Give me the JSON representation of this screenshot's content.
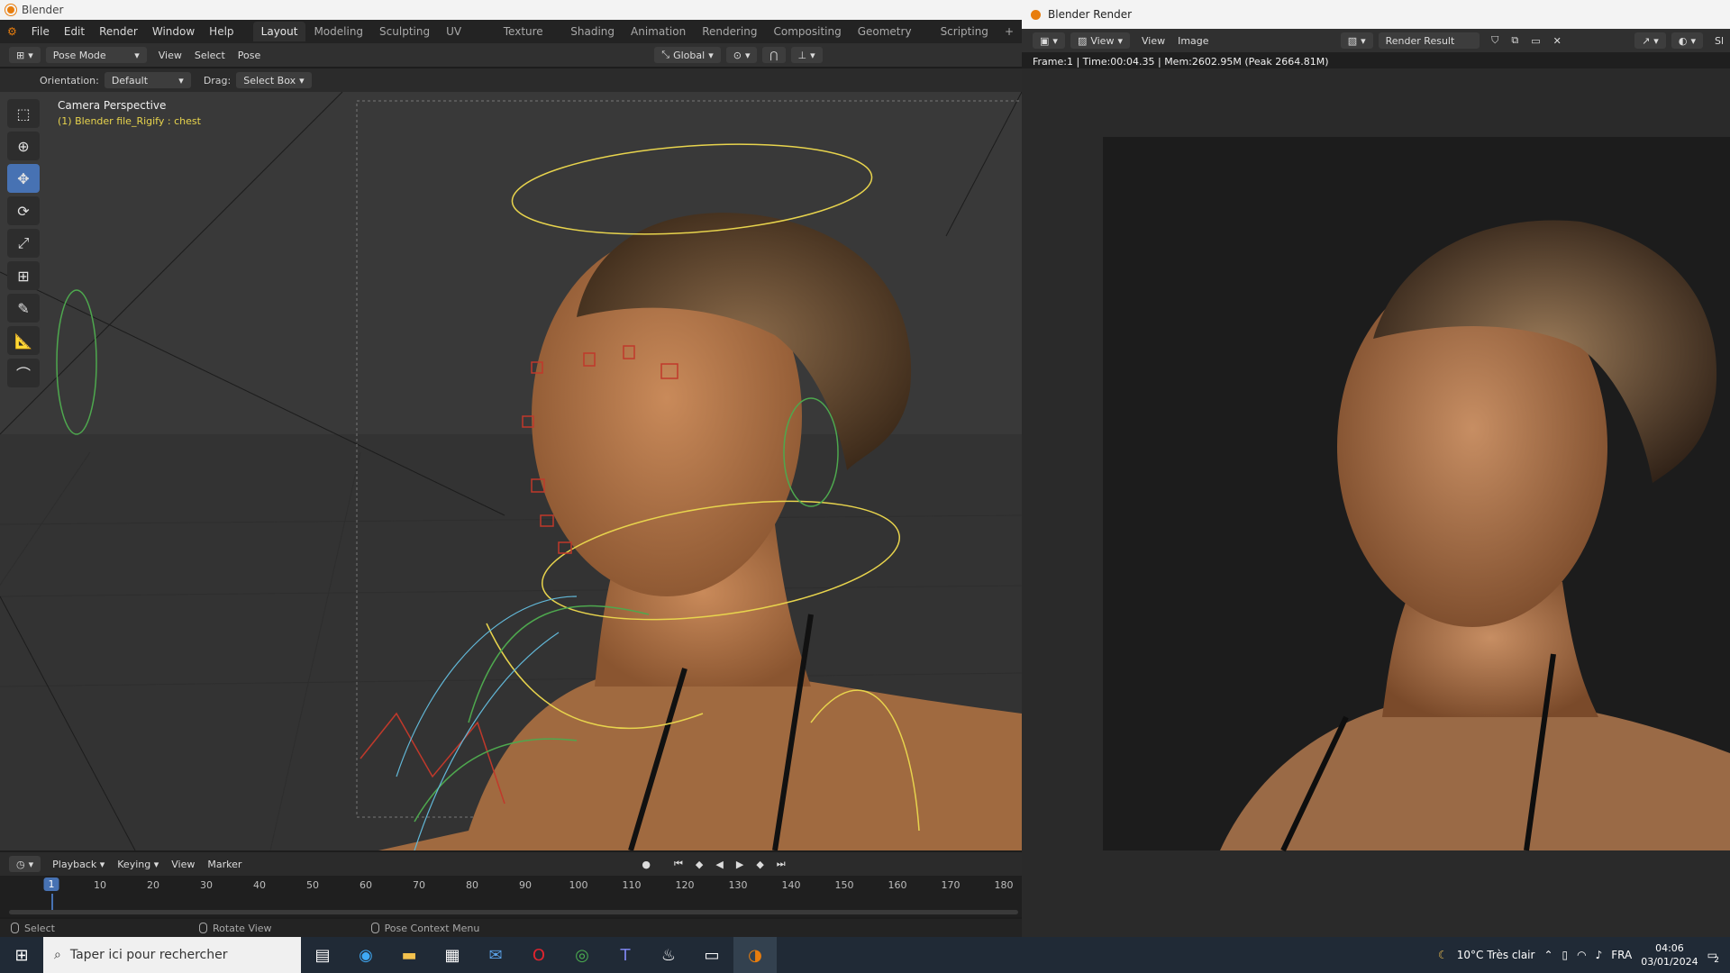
{
  "window": {
    "title": "Blender"
  },
  "menu": {
    "items": [
      "File",
      "Edit",
      "Render",
      "Window",
      "Help"
    ]
  },
  "workspaces": [
    {
      "label": "Layout",
      "active": true
    },
    {
      "label": "Modeling"
    },
    {
      "label": "Sculpting"
    },
    {
      "label": "UV Editing"
    },
    {
      "label": "Texture Paint"
    },
    {
      "label": "Shading"
    },
    {
      "label": "Animation"
    },
    {
      "label": "Rendering"
    },
    {
      "label": "Compositing"
    },
    {
      "label": "Geometry Nodes"
    },
    {
      "label": "Scripting"
    }
  ],
  "add_workspace": "+",
  "viewport_header": {
    "mode": "Pose Mode",
    "menus": [
      "View",
      "Select",
      "Pose"
    ],
    "transform_orientation": "Global"
  },
  "tool_header": {
    "orientation_label": "Orientation:",
    "orientation_value": "Default",
    "drag_label": "Drag:",
    "drag_value": "Select Box"
  },
  "viewport_overlay": {
    "view_name": "Camera Perspective",
    "object_info": "(1) Blender file_Rigify : chest"
  },
  "tools": [
    {
      "name": "select-box-icon",
      "glyph": "⬚",
      "active": false
    },
    {
      "name": "cursor-icon",
      "glyph": "⊕",
      "active": false
    },
    {
      "name": "move-icon",
      "glyph": "✥",
      "active": true
    },
    {
      "name": "rotate-icon",
      "glyph": "⟳",
      "active": false
    },
    {
      "name": "scale-icon",
      "glyph": "⤢",
      "active": false
    },
    {
      "name": "transform-icon",
      "glyph": "⊞",
      "active": false
    },
    {
      "name": "annotate-icon",
      "glyph": "✎",
      "active": false
    },
    {
      "name": "measure-icon",
      "glyph": "📐",
      "active": false
    },
    {
      "name": "relax-pose-icon",
      "glyph": "⌒",
      "active": false
    }
  ],
  "timeline": {
    "menus": [
      "Playback",
      "Keying",
      "View",
      "Marker"
    ],
    "current_frame": "1",
    "ticks": [
      "10",
      "20",
      "30",
      "40",
      "50",
      "60",
      "70",
      "80",
      "90",
      "100",
      "110",
      "120",
      "130",
      "140",
      "150",
      "160",
      "170",
      "180"
    ]
  },
  "statusbar": {
    "select": "Select",
    "rotate": "Rotate View",
    "context": "Pose Context Menu"
  },
  "render_window": {
    "title": "Blender Render",
    "menus": [
      "View",
      "View",
      "Image"
    ],
    "slot": "Render Result",
    "info": "Frame:1 | Time:00:04.35 | Mem:2602.95M (Peak 2664.81M)",
    "edge_text": "Sl"
  },
  "taskbar": {
    "search_placeholder": "Taper ici pour rechercher",
    "weather": "10°C  Très clair",
    "language": "FRA",
    "time": "04:06",
    "date": "03/01/2024",
    "notifications": "2"
  },
  "colors": {
    "accent": "#4772b3",
    "bone_yellow": "#e8d44d",
    "bone_red": "#c0392b",
    "bone_green": "#4ea84e",
    "bone_cyan": "#62b8d8",
    "blender_orange": "#e87d0d"
  }
}
